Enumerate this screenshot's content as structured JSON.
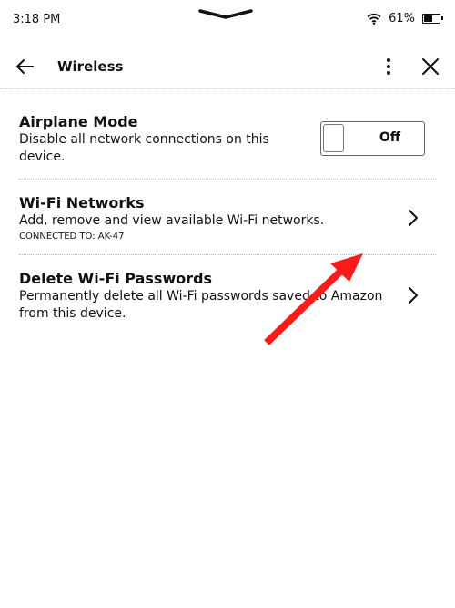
{
  "status_bar": {
    "time": "3:18 PM",
    "battery_text": "61%",
    "battery_level": 0.61,
    "icons": [
      "pull-down-handle-icon",
      "wifi-icon",
      "battery-icon"
    ]
  },
  "header": {
    "title": "Wireless",
    "icons": [
      "back-arrow-icon",
      "more-vertical-icon",
      "close-icon"
    ]
  },
  "settings": {
    "airplane": {
      "title": "Airplane Mode",
      "description": "Disable all network connections on this device.",
      "toggle_label": "Off",
      "toggle_on": false
    },
    "wifi": {
      "title": "Wi-Fi Networks",
      "description": "Add, remove and view available Wi-Fi networks.",
      "status": "CONNECTED TO: AK-47"
    },
    "delete_passwords": {
      "title": "Delete Wi-Fi Passwords",
      "description": "Permanently delete all Wi-Fi passwords saved to Amazon from this device."
    }
  },
  "annotation": {
    "type": "arrow",
    "color": "#ff1a1a",
    "points_to": "wifi-networks-chevron"
  }
}
